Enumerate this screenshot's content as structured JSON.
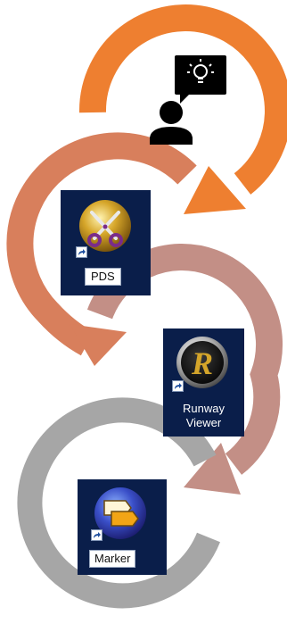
{
  "colors": {
    "orange": "#ee7f30",
    "salmon": "#d87f5c",
    "rose": "#c38f86",
    "gray": "#a6a6a6",
    "tile_bg": "#0a1e4a",
    "person": "#000000",
    "bubble": "#000000"
  },
  "figure": {
    "person_icon": "person-idea-icon",
    "lightbulb_icon": "lightbulb-icon"
  },
  "apps": [
    {
      "label": "PDS",
      "icon": "pds-scissors-icon"
    },
    {
      "label": "Runway\nViewer",
      "icon": "runway-r-icon"
    },
    {
      "label": "Marker",
      "icon": "marker-tags-icon"
    }
  ]
}
